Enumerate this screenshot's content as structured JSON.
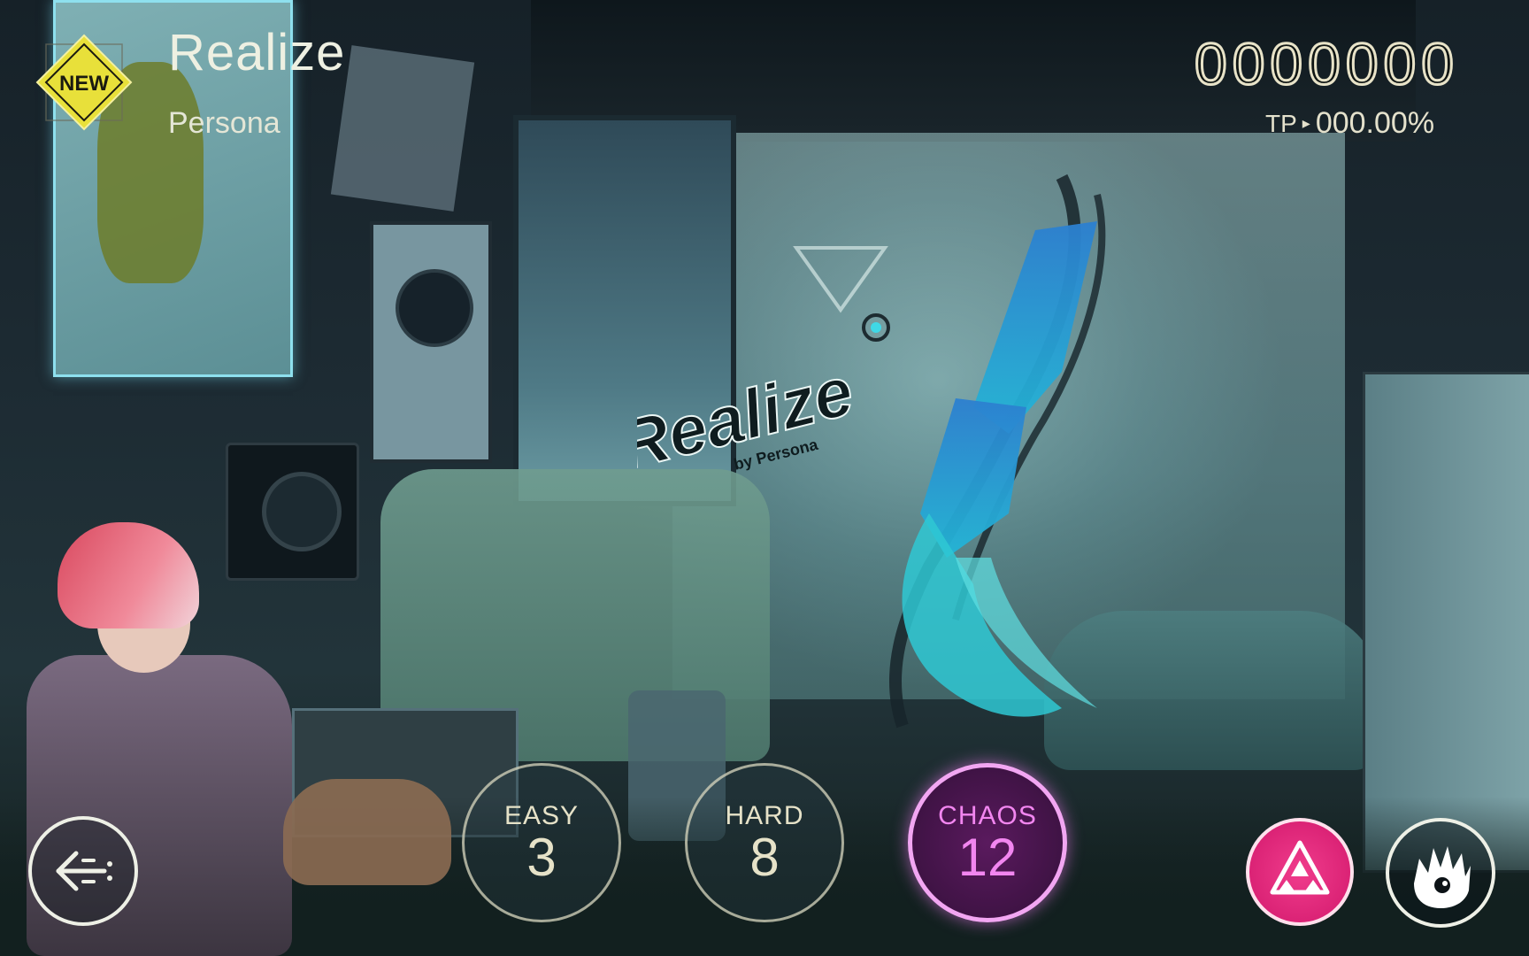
{
  "song": {
    "title": "Realize",
    "artist": "Persona",
    "badge": "NEW"
  },
  "score": {
    "value": "0000000",
    "tp_label": "TP",
    "tp_value": "000.00%"
  },
  "jacket": {
    "logo_title": "Realize",
    "logo_byline": "by Persona"
  },
  "difficulties": [
    {
      "name": "EASY",
      "level": "3",
      "selected": false
    },
    {
      "name": "HARD",
      "level": "8",
      "selected": false
    },
    {
      "name": "CHAOS",
      "level": "12",
      "selected": true
    }
  ],
  "colors": {
    "chaos_accent": "#f286f0",
    "badge_yellow": "#e8e03a",
    "mode_button": "#e02a7c",
    "hud_text": "#e8e3c8"
  },
  "icons": {
    "back": "back-arrow-icon",
    "mode": "triangle-mode-icon",
    "character": "character-face-icon"
  }
}
